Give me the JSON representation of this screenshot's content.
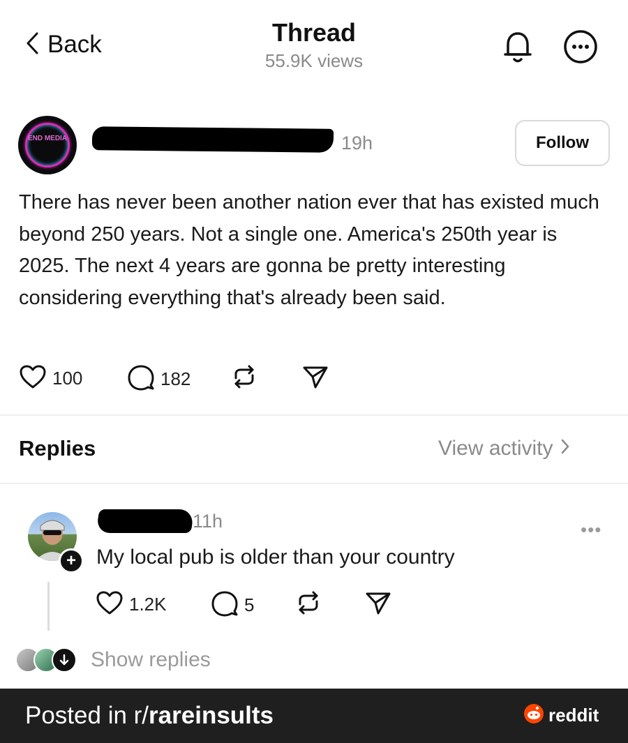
{
  "header": {
    "back_label": "Back",
    "title": "Thread",
    "views": "55.9K views",
    "icons": [
      "chevron-left-icon",
      "bell-icon",
      "more-circle-icon"
    ]
  },
  "post": {
    "avatar_logo_text": "END MEDIA",
    "time": "19h",
    "follow_label": "Follow",
    "text": "There has never been another nation ever that has existed much beyond 250 years. Not a single one. America's 250th year is 2025. The next 4 years are gonna be pretty interesting considering everything that's already been said.",
    "likes": "100",
    "comments": "182"
  },
  "replies_section": {
    "label": "Replies",
    "view_activity": "View activity"
  },
  "reply": {
    "time": "11h",
    "more": "•••",
    "text": "My local pub is older than your country",
    "likes": "1.2K",
    "comments": "5",
    "show_replies": "Show replies"
  },
  "footer": {
    "posted_prefix": "Posted in r/",
    "subreddit": "rareinsults",
    "brand": "reddit",
    "brand_color": "#ff4500",
    "background": "#1f1f1f"
  }
}
